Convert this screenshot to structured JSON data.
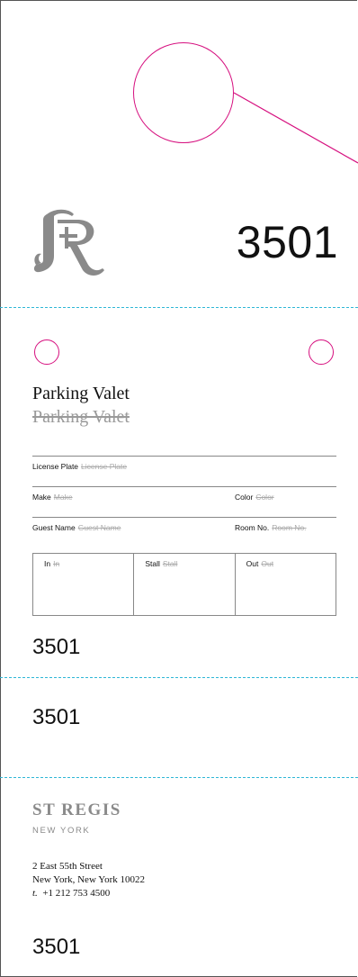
{
  "header": {
    "ticket_number": "3501",
    "logo_monogram": "StRegis-R-monogram"
  },
  "form": {
    "title": "Parking Valet",
    "title_ghost": "Parking Valet",
    "fields": {
      "license_plate": {
        "label": "License Plate",
        "placeholder": "License Plate"
      },
      "make": {
        "label": "Make",
        "placeholder": "Make"
      },
      "color": {
        "label": "Color",
        "placeholder": "Color"
      },
      "guest_name": {
        "label": "Guest Name",
        "placeholder": "Guest Name"
      },
      "room_no": {
        "label": "Room No.",
        "placeholder": "Room No."
      }
    },
    "grid": [
      {
        "label": "In",
        "placeholder": "In"
      },
      {
        "label": "Stall",
        "placeholder": "Stall"
      },
      {
        "label": "Out",
        "placeholder": "Out"
      }
    ],
    "ticket_number": "3501"
  },
  "stub": {
    "ticket_number": "3501"
  },
  "footer": {
    "brand": "ST REGIS",
    "city": "NEW YORK",
    "address_line1": "2 East 55th Street",
    "address_line2": "New York, New York 10022",
    "phone_prefix": "t.",
    "phone": "+1 212 753 4500",
    "ticket_number": "3501"
  },
  "colors": {
    "accent_magenta": "#d6107f",
    "perforation": "#2fb7d6",
    "logo_gray": "#8a8a8a"
  }
}
